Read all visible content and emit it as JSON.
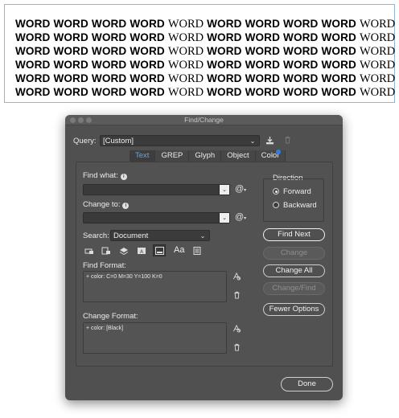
{
  "document": {
    "lines": [
      [
        "WORD",
        "WORD",
        "WORD",
        "WORD",
        "WORD",
        "WORD",
        "WORD",
        "WORD",
        "WORD",
        "WORD"
      ],
      [
        "WORD",
        "WORD",
        "WORD",
        "WORD",
        "WORD",
        "WORD",
        "WORD",
        "WORD",
        "WORD",
        "WORD"
      ],
      [
        "WORD",
        "WORD",
        "WORD",
        "WORD",
        "WORD",
        "WORD",
        "WORD",
        "WORD",
        "WORD",
        "WORD"
      ],
      [
        "WORD",
        "WORD",
        "WORD",
        "WORD",
        "WORD",
        "WORD",
        "WORD",
        "WORD",
        "WORD",
        "WORD"
      ],
      [
        "WORD",
        "WORD",
        "WORD",
        "WORD",
        "WORD",
        "WORD",
        "WORD",
        "WORD",
        "WORD",
        "WORD"
      ],
      [
        "WORD",
        "WORD",
        "WORD",
        "WORD",
        "WORD",
        "WORD",
        "WORD",
        "WORD",
        "WORD",
        "WORD"
      ]
    ],
    "serif_positions": [
      4,
      9
    ]
  },
  "dialog": {
    "title": "Find/Change",
    "query_label": "Query:",
    "query_value": "[Custom]",
    "tabs": [
      "Text",
      "GREP",
      "Glyph",
      "Object",
      "Color"
    ],
    "active_tab": "Text",
    "find_what_label": "Find what:",
    "find_what_value": "",
    "change_to_label": "Change to:",
    "change_to_value": "",
    "direction_label": "Direction",
    "direction_options": [
      "Forward",
      "Backward"
    ],
    "direction_selected": "Forward",
    "search_label": "Search:",
    "search_value": "Document",
    "case_toggle": "Aa",
    "find_format_label": "Find Format:",
    "find_format_value": "+ color: C=0 M=30 Y=100 K=0",
    "change_format_label": "Change Format:",
    "change_format_value": "+ color: [Black]",
    "buttons": {
      "find_next": "Find Next",
      "change": "Change",
      "change_all": "Change All",
      "change_find": "Change/Find",
      "fewer_options": "Fewer Options",
      "done": "Done"
    },
    "colors": {
      "dialog_bg": "#505050",
      "accent_tab": "#52a9ff",
      "dot": "#2c7fe0"
    }
  }
}
